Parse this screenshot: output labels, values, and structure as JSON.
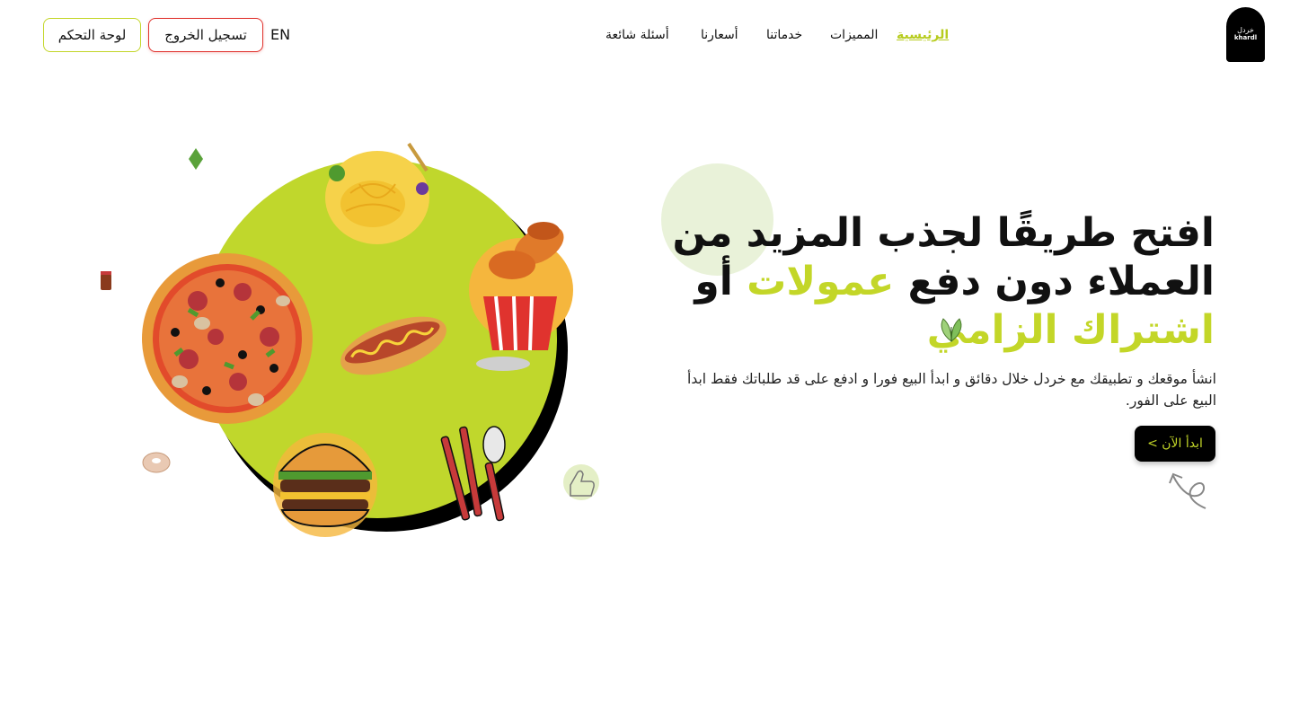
{
  "header": {
    "logo": {
      "arabic": "خردل",
      "latin": "khardl"
    },
    "nav": [
      {
        "label": "الرئيسية",
        "active": true
      },
      {
        "label": "المميزات",
        "active": false
      },
      {
        "label": "خدماتنا",
        "active": false
      },
      {
        "label": "أسعارنا",
        "active": false
      },
      {
        "label": "أسئلة شائعة",
        "active": false
      }
    ],
    "lang_label": "EN",
    "logout_label": "تسجيل الخروج",
    "dashboard_label": "لوحة التحكم"
  },
  "hero": {
    "line1": "افتح طريقًا لجذب المزيد من",
    "line2_part1": "العملاء دون دفع",
    "line2_highlight": "عمولات",
    "line2_part2": "أو",
    "line3_highlight": "اشتراك الزامي",
    "paragraph": "انشأ موقعك و تطبيقك مع خردل خلال دقائق و ابدأ البيع فورا و ادفع على قد طلباتك فقط ابدأ البيع على الفور.",
    "cta_label": "ابدأ الآن >"
  },
  "colors": {
    "accent": "#c3d628",
    "deco_circle": "#e9f2d9",
    "logout_border": "#e0332e",
    "cta_bg": "#000000"
  },
  "icons": [
    "leaf-icon",
    "curly-arrow-icon",
    "thumbs-up-icon"
  ]
}
